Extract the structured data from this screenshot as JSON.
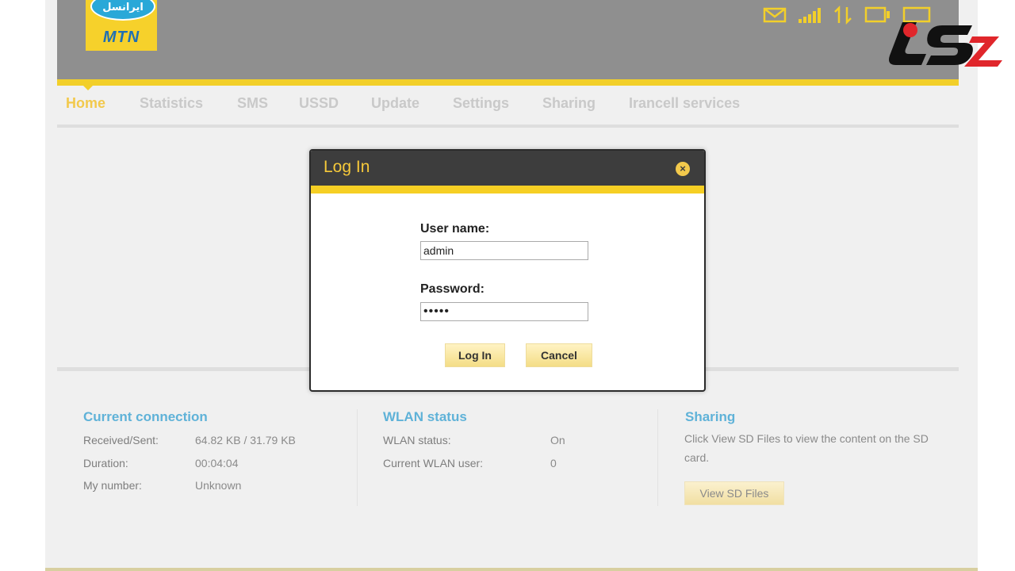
{
  "brand": {
    "operator_farsi": "ایرانسل",
    "operator_latin": "MTN"
  },
  "status_icons": [
    "envelope-icon",
    "signal-bars-icon",
    "data-transfer-icon",
    "tv-icon",
    "monitor-icon"
  ],
  "nav": {
    "items": [
      {
        "label": "Home",
        "active": true
      },
      {
        "label": "Statistics",
        "active": false
      },
      {
        "label": "SMS",
        "active": false
      },
      {
        "label": "USSD",
        "active": false
      },
      {
        "label": "Update",
        "active": false
      },
      {
        "label": "Settings",
        "active": false
      },
      {
        "label": "Sharing",
        "active": false
      },
      {
        "label": "Irancell services",
        "active": false
      }
    ]
  },
  "dialog": {
    "title": "Log In",
    "close_glyph": "×",
    "username_label": "User name:",
    "username_value": "admin",
    "password_label": "Password:",
    "password_value": "•••••",
    "login_label": "Log In",
    "cancel_label": "Cancel"
  },
  "current_connection": {
    "title": "Current connection",
    "rows": [
      {
        "key": "Received/Sent:",
        "value": "64.82 KB /  31.79 KB"
      },
      {
        "key": "Duration:",
        "value": "00:04:04"
      },
      {
        "key": "My number:",
        "value": "Unknown"
      }
    ]
  },
  "wlan": {
    "title": "WLAN status",
    "rows": [
      {
        "key": "WLAN status:",
        "value": "On"
      },
      {
        "key": "Current WLAN user:",
        "value": "0"
      }
    ]
  },
  "sharing": {
    "title": "Sharing",
    "text_line1": "Click View SD Files to view the content on the SD",
    "text_line2": "card.",
    "button_label": "View SD Files"
  },
  "colors": {
    "accent_yellow": "#f2cf2a",
    "header_gray": "#8f8f8f",
    "dialog_head": "#3d3d3d",
    "panel_title_blue": "#5fb2d8",
    "corner_logo_red": "#e0262b"
  }
}
